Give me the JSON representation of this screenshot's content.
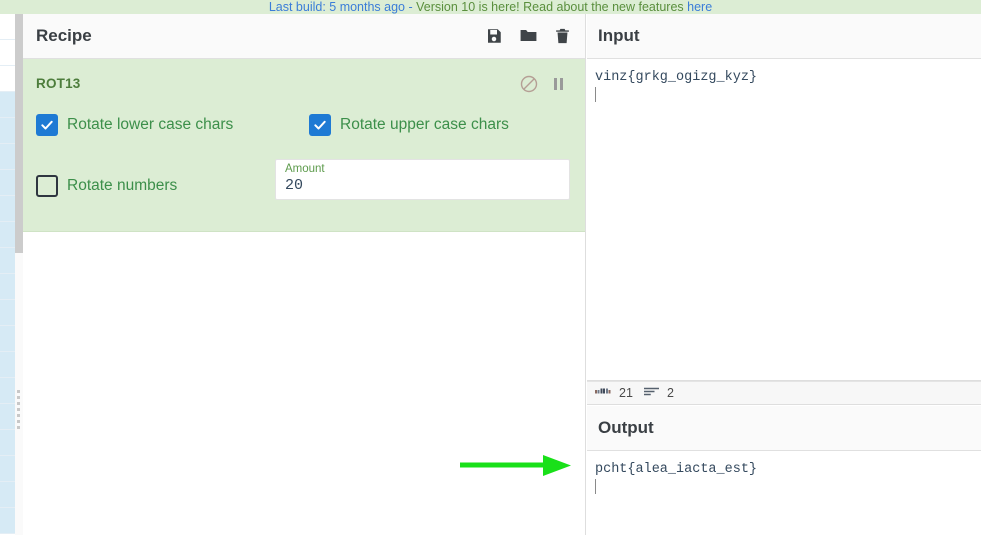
{
  "banner": {
    "prefix": "Last build: 5 months ago",
    "sep": " - ",
    "message": "Version 10 is here! Read about the new features ",
    "link_label": "here",
    "bg_color": "#dcedd4",
    "text_color": "#5a8f3d",
    "link_color": "#3b7dd8"
  },
  "recipe": {
    "title": "Recipe",
    "toolbar": {
      "save_label": "Save recipe",
      "load_label": "Load recipe",
      "clear_label": "Clear recipe"
    },
    "operations": [
      {
        "name": "ROT13",
        "disable_label": "Disable operation",
        "breakpoint_label": "Set breakpoint",
        "args": [
          {
            "type": "checkbox",
            "label": "Rotate lower case chars",
            "checked": true
          },
          {
            "type": "checkbox",
            "label": "Rotate upper case chars",
            "checked": true
          },
          {
            "type": "checkbox",
            "label": "Rotate numbers",
            "checked": false
          },
          {
            "type": "number",
            "label": "Amount",
            "value": "20"
          }
        ]
      }
    ]
  },
  "input": {
    "title": "Input",
    "value": "vinz{grkg_ogizg_kyz}",
    "status": {
      "chars_icon": "abc-icon",
      "chars_value": "21",
      "lines_icon": "lines-icon",
      "lines_value": "2"
    }
  },
  "output": {
    "title": "Output",
    "value": "pcht{alea_iacta_est}"
  },
  "annotation": {
    "arrow_color": "#19e019",
    "arrow_direction": "right",
    "points_at": "output-text"
  },
  "theme": {
    "operation_bg": "#dcedd4",
    "checkbox_on": "#1e7ad4",
    "header_bg": "#fafafa",
    "mono_text": "#34495e"
  }
}
